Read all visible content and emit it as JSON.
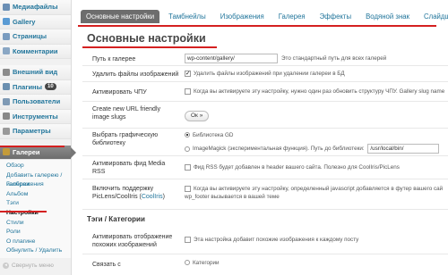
{
  "sidebar": {
    "items": [
      {
        "label": "Медиафайлы",
        "color": "#6b8fb5"
      },
      {
        "label": "Gallery",
        "color": "#5a9bd4"
      },
      {
        "label": "Страницы",
        "color": "#7a9cc0"
      },
      {
        "label": "Комментарии",
        "color": "#8aa7c4"
      }
    ],
    "items2": [
      {
        "label": "Внешний вид",
        "color": "#8b8b8b"
      },
      {
        "label": "Плагины",
        "color": "#6a8fb0",
        "badge": "10"
      },
      {
        "label": "Пользователи",
        "color": "#7f9ab5"
      },
      {
        "label": "Инструменты",
        "color": "#888888"
      },
      {
        "label": "Параметры",
        "color": "#999999"
      }
    ],
    "active": {
      "label": "Галереи",
      "color": "#c49b3a"
    },
    "submenu": [
      "Обзор",
      "Добавить галерею / изображения",
      "Галереи",
      "Альбом",
      "Тэги",
      "Настройки",
      "Стили",
      "Роли",
      "О плагине",
      "Обнулить / Удалить"
    ],
    "current_sub": "Настройки",
    "collapse": "Свернуть меню"
  },
  "tabs": [
    "Основные настройки",
    "Тамбнейлы",
    "Изображения",
    "Галерея",
    "Эффекты",
    "Водяной знак",
    "Слайдшоу"
  ],
  "page_title": "Основные настройки",
  "settings": {
    "path_label": "Путь к галерее",
    "path_value": "wp-content/gallery/",
    "path_hint": "Это стандартный путь для всех галерей",
    "delete_label": "Удалить файлы изображений",
    "delete_hint": "Удалить файлы изображений при удалении галереи в БД",
    "chpu_label": "Активировать ЧПУ",
    "chpu_hint": "Когда вы активируете эту настройку, нужно один раз обновить структуру ЧПУ. Gallery slug name",
    "slugs_label": "Create new URL friendly image slugs",
    "ok_button": "Ок »",
    "lib_label": "Выбрать графическую библиотеку",
    "lib_gd": "Библиотека GD",
    "lib_imagick": "ImageMagick (экспериментальная функция). Путь до библиотеки:",
    "lib_path": "/usr/local/bin/",
    "rss_label": "Активировать фид Media RSS",
    "rss_hint": "Фид RSS будет добавлен в header вашего сайта. Полезно для CoolIris/PicLens",
    "piclens_label_a": "Включить поддержку PicLens/CoolIris (",
    "piclens_link": "CoolIris",
    "piclens_label_b": ")",
    "piclens_hint1": "Когда вы активируете эту настройку, определенный javascript добавляется в футер вашего сай",
    "piclens_hint2": "wp_footer вызывается в вашей теме",
    "tags_section": "Тэги / Категории",
    "related_label": "Активировать отображение похожих изображений",
    "related_hint": "Эта настройка добавит похожие изображения к каждому посту",
    "link_label": "Связать с",
    "link_hint": "Категории"
  },
  "colors": {
    "annotation": "#d42020",
    "link": "#21759b",
    "active_tab": "#6d6d6d"
  }
}
